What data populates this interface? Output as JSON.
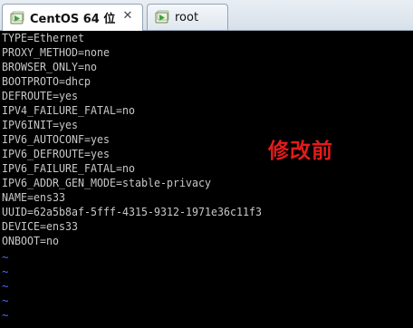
{
  "tabs": [
    {
      "label": "CentOS 64 位",
      "active": true,
      "icon": "vm-play-icon"
    },
    {
      "label": "root",
      "active": false,
      "icon": "vm-play-icon"
    }
  ],
  "terminal": {
    "lines": [
      "TYPE=Ethernet",
      "PROXY_METHOD=none",
      "BROWSER_ONLY=no",
      "BOOTPROTO=dhcp",
      "DEFROUTE=yes",
      "IPV4_FAILURE_FATAL=no",
      "IPV6INIT=yes",
      "IPV6_AUTOCONF=yes",
      "IPV6_DEFROUTE=yes",
      "IPV6_FAILURE_FATAL=no",
      "IPV6_ADDR_GEN_MODE=stable-privacy",
      "NAME=ens33",
      "UUID=62a5b8af-5fff-4315-9312-1971e36c11f3",
      "DEVICE=ens33",
      "ONBOOT=no"
    ],
    "tilde": "~",
    "tilde_count": 5,
    "text_color": "#c8c8c8",
    "tilde_color": "#4f6bff"
  },
  "annotation": {
    "text": "修改前",
    "color": "#e31b1b"
  }
}
